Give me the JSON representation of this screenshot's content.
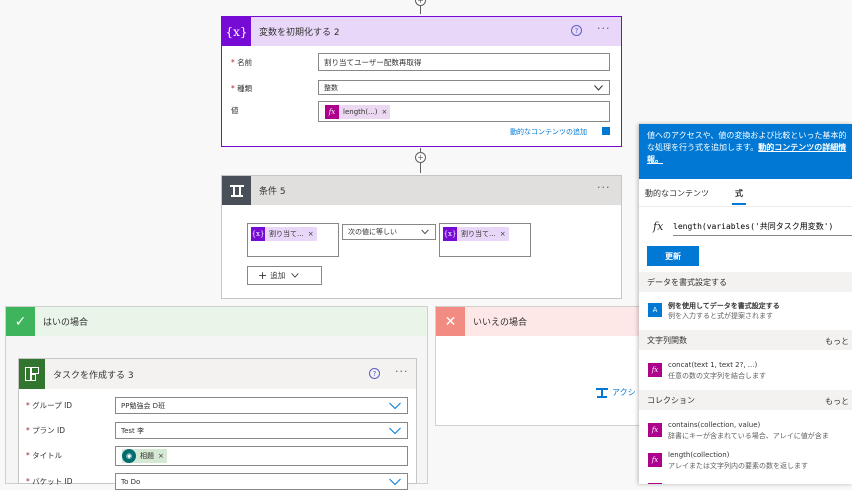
{
  "colors": {
    "variable": "#770bd6",
    "variable_header": "#e8d7f8",
    "condition": "#484f58",
    "yes": "#3eb55c",
    "no": "#f28b82",
    "planner": "#31752f",
    "accent": "#0078d4"
  },
  "init_card": {
    "title": "変数を初期化する 2",
    "name_label": "名前",
    "name_value": "割り当てユーザー配数再取得",
    "type_label": "種類",
    "type_value": "整数",
    "value_label": "値",
    "value_token": "length(...)",
    "dynamic_link": "動的なコンテンツの追加"
  },
  "condition_card": {
    "title": "条件 5",
    "left_token": "割り当て...",
    "operator": "次の値に等しい",
    "right_token": "割り当て...",
    "add_label": "追加"
  },
  "yes_branch": {
    "title": "はいの場合"
  },
  "no_branch": {
    "title": "いいえの場合",
    "action_partial": "アクシ"
  },
  "task_card": {
    "title": "タスクを作成する 3",
    "group_label": "グループ ID",
    "group_value": "PP勉強会 D班",
    "plan_label": "プラン ID",
    "plan_value": "Test 李",
    "title_label": "タイトル",
    "title_token": "相題",
    "bucket_label": "バケット ID",
    "bucket_value": "To Do"
  },
  "panel": {
    "info_text": "値へのアクセスや、値の変換および比較といった基本的な処理を行う式を追加します。",
    "info_link": "動的コンテンツの詳細情報。",
    "tab_dynamic": "動的なコンテンツ",
    "tab_expression": "式",
    "expression": "length(variables('共同タスク用変数')",
    "update_button": "更新",
    "section_format": "データを書式設定する",
    "format_item_name": "例を使用してデータを書式設定する",
    "format_item_desc": "例を入力すると式が提案されます",
    "section_string": "文字列関数",
    "section_more": "もっと",
    "concat_name": "concat(text 1, text 2?, ...)",
    "concat_desc": "任意の数の文字列を結合します",
    "section_collection": "コレクション",
    "section_more2": "もっと",
    "contains_name": "contains(collection, value)",
    "contains_desc": "辞書にキーが含まれている場合、アレイに値が含ま",
    "length_name": "length(collection)",
    "length_desc": "アレイまたは文字列内の要素の数を返します"
  }
}
